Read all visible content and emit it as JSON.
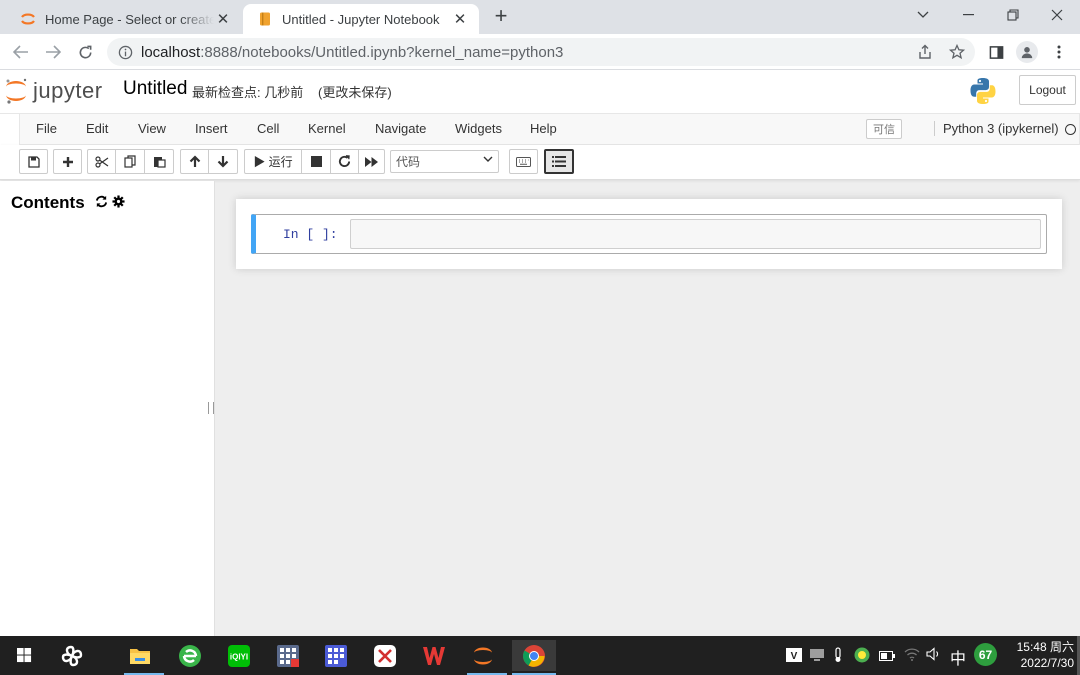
{
  "browser": {
    "tabs": [
      {
        "title": "Home Page - Select or create a notebook",
        "active": false
      },
      {
        "title": "Untitled - Jupyter Notebook",
        "active": true
      }
    ],
    "url_host": "localhost",
    "url_rest": ":8888/notebooks/Untitled.ipynb?kernel_name=python3",
    "icons": [
      "back-icon",
      "forward-icon",
      "reload-icon",
      "info-icon",
      "share-icon",
      "star-icon",
      "sidepanel-icon",
      "profile-icon",
      "kebab-menu-icon"
    ]
  },
  "jupyter": {
    "logo_text": "jupyter",
    "notebook_name": "Untitled",
    "checkpoint": "最新检查点: 几秒前",
    "autosave_status": "(更改未保存)",
    "logout_label": "Logout",
    "menus": [
      "File",
      "Edit",
      "View",
      "Insert",
      "Cell",
      "Kernel",
      "Navigate",
      "Widgets",
      "Help"
    ],
    "trusted_label": "可信",
    "kernel_name": "Python 3 (ipykernel)",
    "run_label": "▶ 运行",
    "cell_type": "代码",
    "toolbar_icons": [
      "save-icon",
      "add-cell-icon",
      "cut-icon",
      "copy-icon",
      "paste-icon",
      "move-up-icon",
      "move-down-icon",
      "run-icon",
      "stop-icon",
      "restart-icon",
      "fast-forward-icon",
      "keyboard-icon",
      "toc-list-icon"
    ]
  },
  "toc": {
    "title": "Contents"
  },
  "cell": {
    "prompt": "In  [  ]:"
  },
  "taskbar": {
    "ime": "中",
    "badge": "67",
    "time": "15:48 周六",
    "date": "2022/7/30"
  },
  "colors": {
    "jupyter_orange": "#f37726",
    "cell_selected": "#42a5f5",
    "prompt": "#303f9f",
    "taskbar": "#202020"
  }
}
